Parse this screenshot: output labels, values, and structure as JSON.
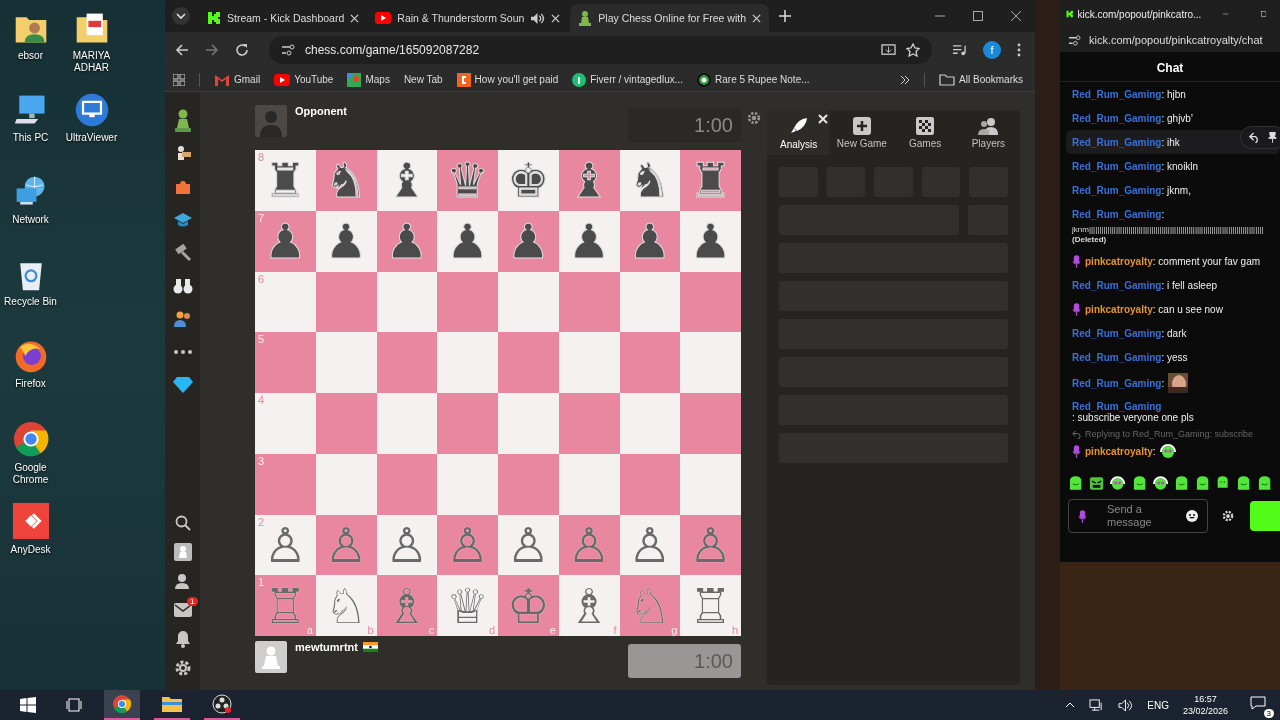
{
  "desktop": {
    "columns": [
      [
        {
          "label": "ebsor",
          "kind": "user-folder"
        },
        {
          "label": "This PC",
          "kind": "computer"
        },
        {
          "label": "Network",
          "kind": "network"
        },
        {
          "label": "Recycle Bin",
          "kind": "recycle-bin"
        },
        {
          "label": "Firefox",
          "kind": "firefox"
        },
        {
          "label": "Google Chrome",
          "kind": "chrome"
        },
        {
          "label": "AnyDesk",
          "kind": "anydesk"
        }
      ],
      [
        {
          "label": "MARIYA ADHAR",
          "kind": "pdf-folder"
        },
        {
          "label": "UltraViewer",
          "kind": "ultraviewer"
        }
      ]
    ]
  },
  "browser": {
    "tabs": [
      {
        "title": "Stream - Kick Dashboard",
        "kind": "kick",
        "selected": false,
        "playing_audio": false
      },
      {
        "title": "Rain & Thunderstorm Soun",
        "kind": "youtube",
        "selected": false,
        "playing_audio": true
      },
      {
        "title": "Play Chess Online for Free with",
        "kind": "chess",
        "selected": true,
        "playing_audio": false
      }
    ],
    "address": "chess.com/game/165092087282",
    "profile_letter": "f",
    "bookmarks": [
      {
        "label": "Gmail",
        "kind": "gmail"
      },
      {
        "label": "YouTube",
        "kind": "youtube"
      },
      {
        "label": "Maps",
        "kind": "maps"
      },
      {
        "label": "New Tab",
        "kind": "none"
      },
      {
        "label": "How you'll get paid",
        "kind": "etsy"
      },
      {
        "label": "Fiverr / vintagedlux...",
        "kind": "fiverr"
      },
      {
        "label": "Rare 5 Rupee Note...",
        "kind": "coin"
      }
    ],
    "all_bookmarks": "All Bookmarks"
  },
  "chess": {
    "nav": [
      {
        "kind": "logo"
      },
      {
        "kind": "play"
      },
      {
        "kind": "puzzles"
      },
      {
        "kind": "learn"
      },
      {
        "kind": "train"
      },
      {
        "kind": "watch"
      },
      {
        "kind": "social"
      },
      {
        "kind": "more"
      },
      {
        "kind": "upgrade"
      }
    ],
    "nav_bottom": [
      {
        "kind": "search"
      },
      {
        "kind": "avatar"
      },
      {
        "kind": "friends"
      },
      {
        "kind": "messages",
        "badge": "1"
      },
      {
        "kind": "notifications"
      },
      {
        "kind": "settings"
      }
    ],
    "opponent": {
      "name": "Opponent",
      "clock": "1:00",
      "avatar": {
        "kind": "silhouette"
      }
    },
    "player": {
      "name": "mewtumrtnt",
      "clock": "1:00",
      "avatar": {
        "kind": "pawn"
      },
      "flag": {
        "kind": "india"
      }
    },
    "board": {
      "ranks": [
        {
          "label": "8",
          "kind": "black",
          "pieces": [
            "♜",
            "♞",
            "♝",
            "♛",
            "♚",
            "♝",
            "♞",
            "♜"
          ]
        },
        {
          "label": "7",
          "kind": "black",
          "pieces": [
            "♟",
            "♟",
            "♟",
            "♟",
            "♟",
            "♟",
            "♟",
            "♟"
          ]
        },
        {
          "label": "6"
        },
        {
          "label": "5"
        },
        {
          "label": "4"
        },
        {
          "label": "3"
        },
        {
          "label": "2",
          "kind": "white",
          "pieces": [
            "♙",
            "♙",
            "♙",
            "♙",
            "♙",
            "♙",
            "♙",
            "♙"
          ]
        },
        {
          "label": "1",
          "kind": "white",
          "pieces": [
            "♖",
            "♘",
            "♗",
            "♕",
            "♔",
            "♗",
            "♘",
            "♖"
          ]
        }
      ],
      "files": [
        "a",
        "b",
        "c",
        "d",
        "e",
        "f",
        "g",
        "h"
      ]
    },
    "panel_tabs": [
      {
        "label": "Analysis",
        "kind": "analysis",
        "selected": true
      },
      {
        "label": "New Game",
        "kind": "new-game",
        "selected": false
      },
      {
        "label": "Games",
        "kind": "games",
        "selected": false
      },
      {
        "label": "Players",
        "kind": "players",
        "selected": false
      }
    ]
  },
  "chat": {
    "window_title": "kick.com/popout/pinkcatro...",
    "address": "kick.com/popout/pinkcatroyalty/chat",
    "title": "Chat",
    "messages": [
      {
        "kind": "text",
        "user": {
          "name": "Red_Rum_Gaming",
          "kind": "viewer"
        },
        "text": ": hjbn",
        "hovered": false
      },
      {
        "kind": "text",
        "user": {
          "name": "Red_Rum_Gaming",
          "kind": "viewer"
        },
        "text": ": ghjvb'",
        "hovered": false
      },
      {
        "kind": "text",
        "user": {
          "name": "Red_Rum_Gaming",
          "kind": "viewer"
        },
        "text": ": ihk",
        "hovered": true
      },
      {
        "kind": "text",
        "user": {
          "name": "Red_Rum_Gaming",
          "kind": "viewer"
        },
        "text": ": knoikln",
        "hovered": false
      },
      {
        "kind": "text",
        "user": {
          "name": "Red_Rum_Gaming",
          "kind": "viewer"
        },
        "text": ": jknm,",
        "hovered": false
      },
      {
        "kind": "deleted",
        "user": {
          "name": "Red_Rum_Gaming",
          "kind": "viewer"
        },
        "text": ":",
        "body": "jknm||||||||||||||||||||||||||||||||||||||||||||||||||||||||||||||||||||||||||||||||||||",
        "note": "(Deleted)",
        "hovered": false
      },
      {
        "kind": "text",
        "user": {
          "name": "pinkcatroyalty",
          "kind": "streamer"
        },
        "text": ": comment your fav gam",
        "hovered": false
      },
      {
        "kind": "text",
        "user": {
          "name": "Red_Rum_Gaming",
          "kind": "viewer"
        },
        "text": ": i fell asleep",
        "hovered": false
      },
      {
        "kind": "text",
        "user": {
          "name": "pinkcatroyalty",
          "kind": "streamer"
        },
        "text": ": can u see now",
        "hovered": false
      },
      {
        "kind": "text",
        "user": {
          "name": "Red_Rum_Gaming",
          "kind": "viewer"
        },
        "text": ": dark",
        "hovered": false
      },
      {
        "kind": "text",
        "user": {
          "name": "Red_Rum_Gaming",
          "kind": "viewer"
        },
        "text": ": yess",
        "hovered": false
      },
      {
        "user": {
          "name": "Red_Rum_Gaming",
          "kind": "viewer"
        },
        "text": ":",
        "hovered": false
      },
      {
        "kind": "text",
        "user": {
          "name": "Red_Rum_Gaming",
          "kind": "viewer"
        },
        "text": ": subscribe veryone one pls",
        "hovered": false
      },
      {
        "kind": "emote",
        "user": {
          "name": "pinkcatroyalty",
          "kind": "streamer"
        },
        "text": ":",
        "reply": "Replying to Red_Rum_Gaming: subscribe",
        "hovered": false
      }
    ],
    "emotes": [
      {
        "kind": "blob"
      },
      {
        "kind": "angry"
      },
      {
        "kind": "headphones"
      },
      {
        "kind": "blob"
      },
      {
        "kind": "headphones"
      },
      {
        "kind": "blob"
      },
      {
        "kind": "blob"
      },
      {
        "kind": "small"
      },
      {
        "kind": "blob"
      },
      {
        "kind": "blob"
      }
    ],
    "input": {
      "placeholder": "Send a message"
    }
  },
  "taskbar": {
    "apps": [
      {
        "kind": "chrome",
        "active": true
      },
      {
        "kind": "explorer",
        "active": false
      },
      {
        "kind": "obs",
        "active": false
      }
    ],
    "language": "ENG",
    "time": "16:57",
    "date": "23/02/2026",
    "notifications": "3"
  }
}
